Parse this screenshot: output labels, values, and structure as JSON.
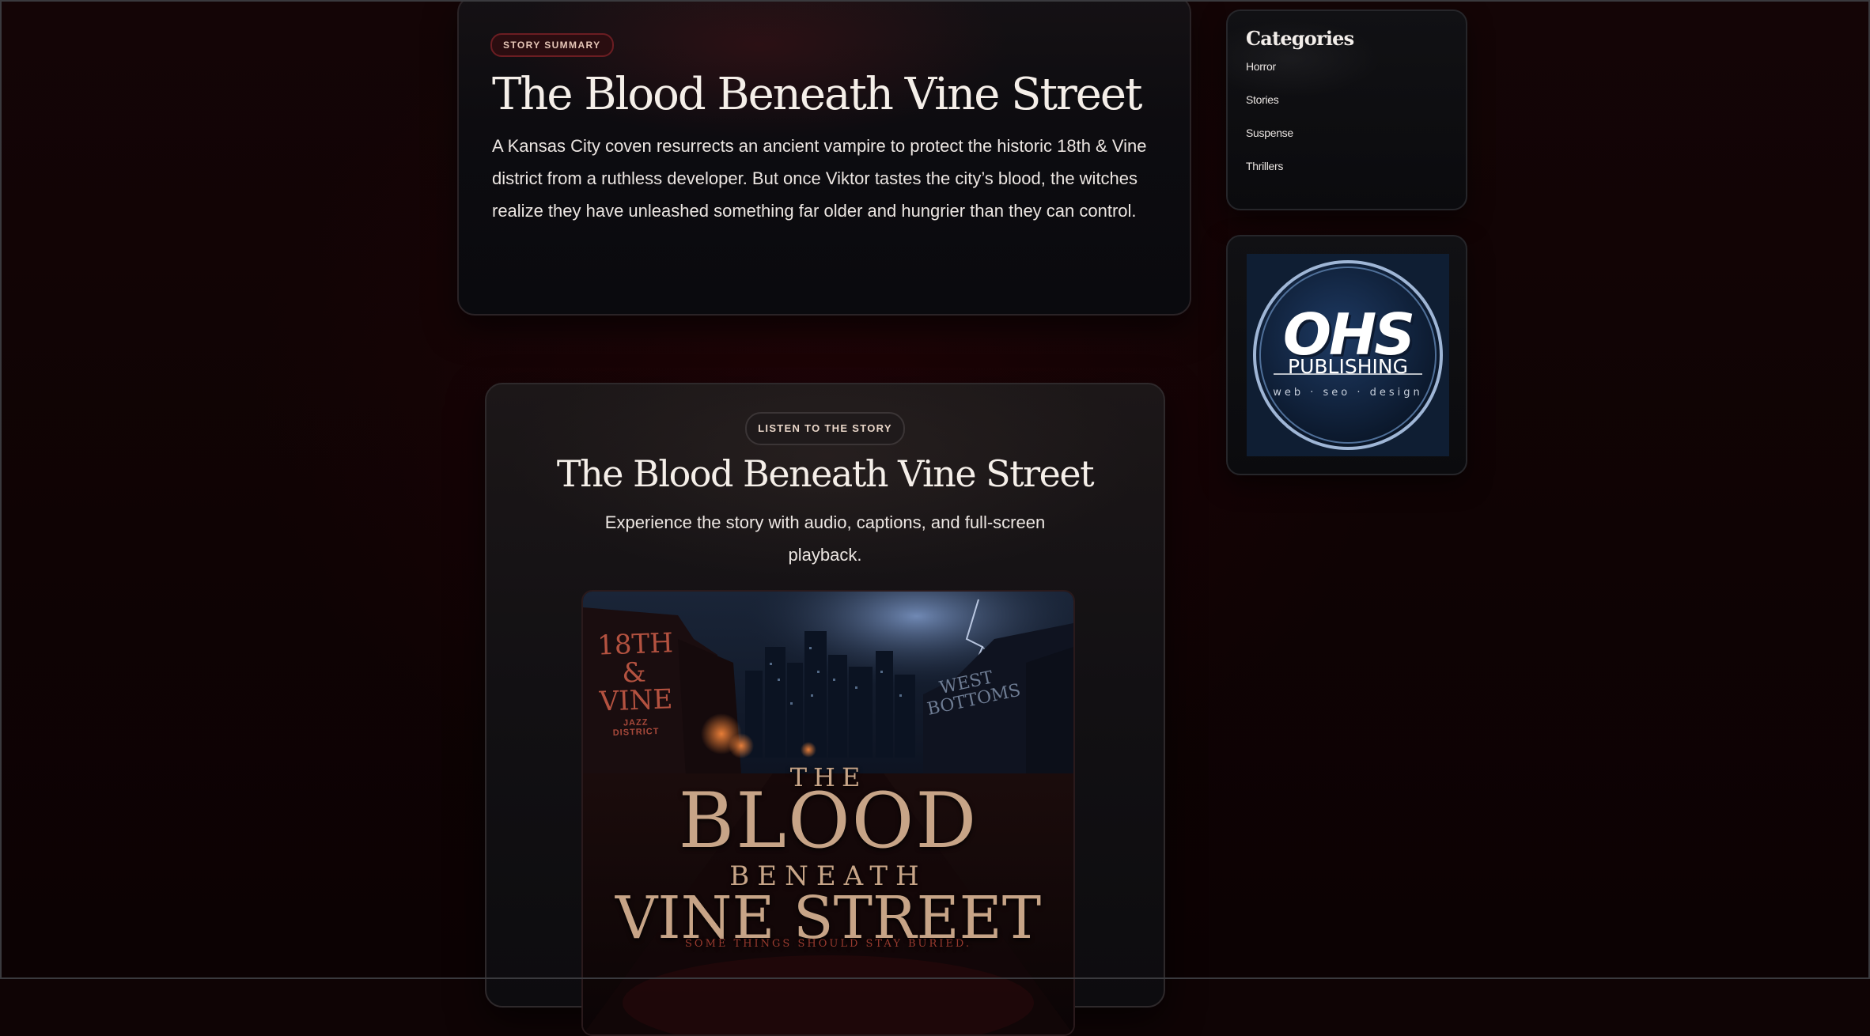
{
  "summary": {
    "pill": "STORY SUMMARY",
    "title": "The Blood Beneath Vine Street",
    "text": "A Kansas City coven resurrects an ancient vampire to protect the historic 18th & Vine district from a ruthless developer. But once Viktor tastes the city’s blood, the witches realize they have unleashed something far older and hungrier than they can control."
  },
  "listen": {
    "pill": "LISTEN TO THE STORY",
    "title": "The Blood Beneath Vine Street",
    "subtitle": "Experience the story with audio, captions, and full-screen playback."
  },
  "cover": {
    "sign_left_1": "18TH",
    "sign_left_2": "&",
    "sign_left_3": "VINE",
    "sign_left_4": "JAZZ DISTRICT",
    "sign_right_1": "WEST",
    "sign_right_2": "BOTTOMS",
    "title_the": "THE",
    "title_blood": "BLOOD",
    "title_beneath": "BENEATH",
    "title_vine": "VINE STREET",
    "tagline": "SOME THINGS SHOULD STAY BURIED."
  },
  "sidebar": {
    "categories_title": "Categories",
    "categories": [
      "Horror",
      "Stories",
      "Suspense",
      "Thrillers"
    ],
    "logo": {
      "mark": "OHS",
      "name": "PUBLISHING",
      "tagline": "web · seo · design"
    }
  },
  "colors": {
    "background": "#0f0405",
    "card": "#0d0c10",
    "accent_red": "#6b1d22",
    "cover_gold": "#c7a487",
    "logo_blue": "#0f1e33"
  }
}
